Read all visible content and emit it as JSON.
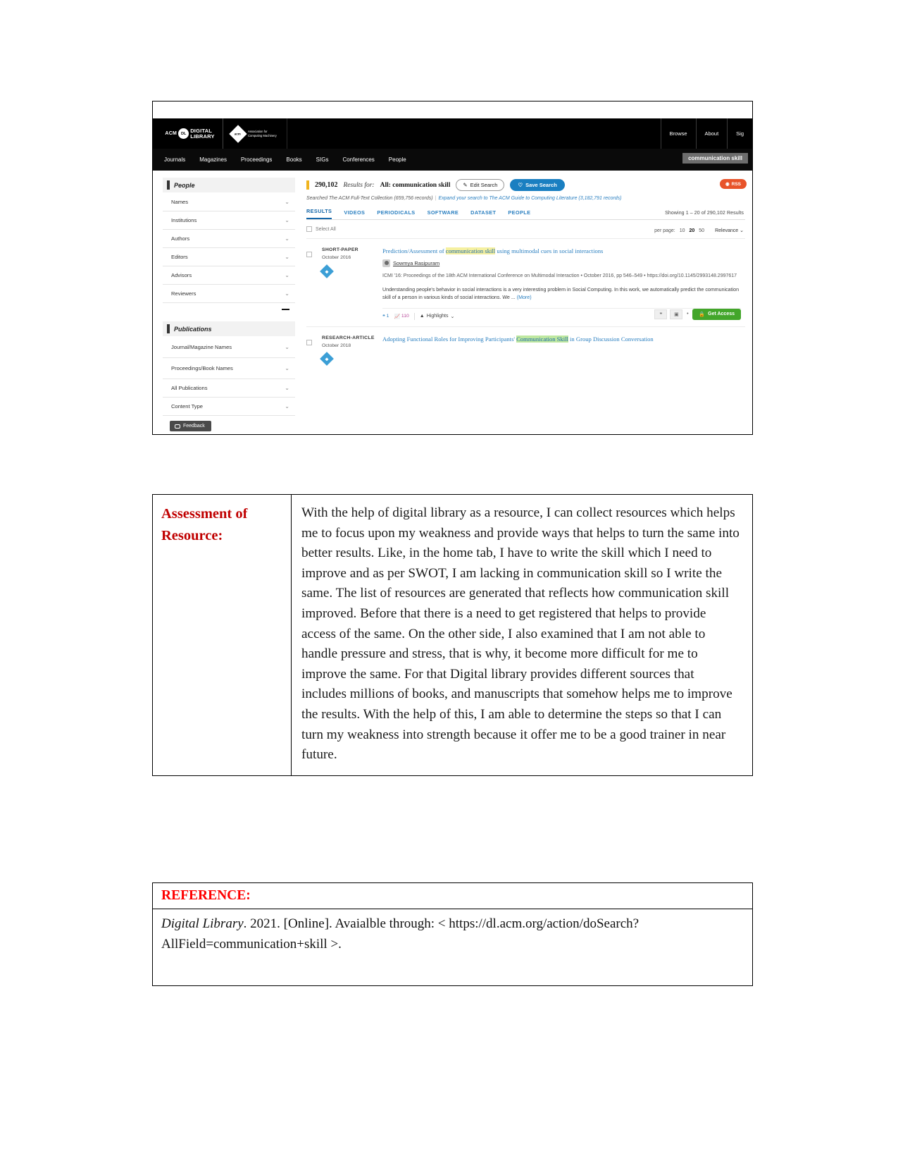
{
  "screenshot": {
    "topbar": {
      "logo_acm": "ACM",
      "logo_dl": "DL",
      "logo_digital": "DIGITAL",
      "logo_library": "LIBRARY",
      "assoc_mark": "acm",
      "assoc_line1": "Association for",
      "assoc_line2": "Computing Machinery",
      "links": [
        "Browse",
        "About",
        "Sig"
      ]
    },
    "nav": {
      "items": [
        "Journals",
        "Magazines",
        "Proceedings",
        "Books",
        "SIGs",
        "Conferences",
        "People"
      ],
      "search_value": "communication skill"
    },
    "facets": [
      {
        "group": "People",
        "rows": [
          "Names",
          "Institutions",
          "Authors",
          "Editors",
          "Advisors",
          "Reviewers"
        ]
      },
      {
        "group": "Publications",
        "rows": [
          "Journal/Magazine Names",
          "Proceedings/Book Names",
          "All Publications",
          "Content Type"
        ]
      }
    ],
    "feedback_label": "Feedback",
    "results_header": {
      "count": "290,102",
      "results_for": "Results for:",
      "query": "All: communication skill",
      "edit_search": "Edit Search",
      "save_search": "Save Search",
      "rss": "RSS",
      "searched_text": "Searched The ACM Full-Text Collection (659,756 records)",
      "expand_text": "Expand your search to The ACM Guide to Computing Literature (3,182,791 records)"
    },
    "tabs": [
      {
        "label": "RESULTS",
        "active": true
      },
      {
        "label": "VIDEOS",
        "active": false
      },
      {
        "label": "PERIODICALS",
        "active": false
      },
      {
        "label": "SOFTWARE",
        "active": false
      },
      {
        "label": "DATASET",
        "active": false
      },
      {
        "label": "PEOPLE",
        "active": false
      }
    ],
    "showing": "Showing 1 – 20 of 290,102 Results",
    "toolbar": {
      "select_all": "Select All",
      "per_page_label": "per page:",
      "per_page_options": [
        "10",
        "20",
        "50"
      ],
      "per_page_selected": "20",
      "sort_label": "Relevance"
    },
    "results": [
      {
        "type": "SHORT-PAPER",
        "date": "October 2016",
        "title_pre": "Prediction/Assessment of ",
        "title_hl": "communication skill",
        "title_post": " using multimodal cues in social interactions",
        "author": "Sowmya Rasipuram",
        "venue": "ICMI '16: Proceedings of the 18th ACM International Conference on Multimodal Interaction • October 2016, pp 546–549 • https://doi.org/10.1145/2993148.2997617",
        "abstract": "Understanding people's behavior in social interactions is a very interesting problem in Social Computing. In this work, we automatically predict the communication skill of a person in various kinds of social interactions. We ...",
        "more": "(More)",
        "citations": "1",
        "downloads": "110",
        "highlights": "Highlights",
        "get_access": "Get Access"
      },
      {
        "type": "RESEARCH-ARTICLE",
        "date": "October 2018",
        "title_pre": "Adopting Functional Roles for Improving Participants' ",
        "title_hl": "Communication Skill",
        "title_post": " in Group Discussion Conversation"
      }
    ]
  },
  "assessment": {
    "label": "Assessment of Resource:",
    "body": " With the help of digital library as a resource, I can collect resources which helps me to focus upon my weakness and provide ways that helps to turn the same into better results. Like, in the home tab, I have to write the skill which I need to improve and as per SWOT, I am lacking in communication skill so I write the same. The list of resources are generated that reflects how communication skill improved. Before that there is a need to get registered that helps to provide access of the same.  On the other side, I also examined that I am not able to handle pressure and stress, that is why, it become more difficult for me to improve the same. For that Digital library provides different sources that includes millions of books, and manuscripts that somehow helps me to improve the results. With the help of this, I am able to determine the steps so that I can turn my weakness into strength because it offer me to be a good trainer in near future."
  },
  "reference": {
    "heading": "REFERENCE:",
    "title_italic": "Digital Library",
    "text": ". 2021. [Online]. Avaialble through: < https://dl.acm.org/action/doSearch?AllField=communication+skill >."
  }
}
